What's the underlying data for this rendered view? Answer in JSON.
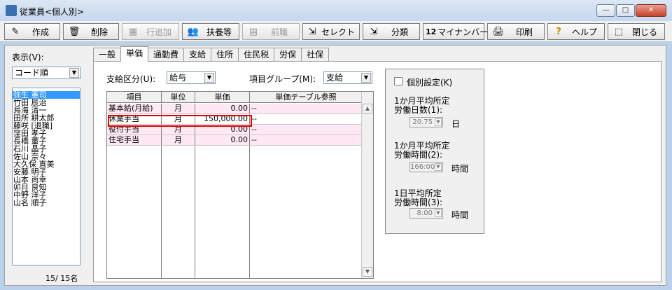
{
  "window": {
    "title": "従業員<個人別>",
    "min_glyph": "—",
    "max_glyph": "□",
    "close_glyph": "✕"
  },
  "toolbar": {
    "buttons": [
      {
        "label": "作成",
        "icon": "✎"
      },
      {
        "label": "削除",
        "icon": "🗑"
      },
      {
        "label": "行追加",
        "icon": "▦"
      },
      {
        "label": "扶養等",
        "icon": "👥"
      },
      {
        "label": "前職",
        "icon": "▤"
      },
      {
        "label": "セレクト",
        "icon": "⇲"
      },
      {
        "label": "分類",
        "icon": "⇲"
      },
      {
        "label": "マイナンバー",
        "icon": "12"
      },
      {
        "label": "印刷",
        "icon": "🖨"
      },
      {
        "label": "ヘルプ",
        "icon": "?"
      },
      {
        "label": "閉じる",
        "icon": "⬚"
      }
    ]
  },
  "left": {
    "display_label": "表示(V):",
    "sort_value": "コード順",
    "employees": [
      "弥生 憲司",
      "竹田 辰治",
      "鳥海 清一",
      "田所 耕太郎",
      "藤咲 [退職]",
      "窪田 孝子",
      "長橋 董子",
      "石川 晶子",
      "佐山 奈々",
      "大久保 直美",
      "安藤 明子",
      "山本 尚幸",
      "卯月 良知",
      "中野 洋子",
      "山名 順子"
    ],
    "count": "15/ 15名"
  },
  "tabs": [
    "一般",
    "単価",
    "通勤費",
    "支給",
    "住所",
    "住民税",
    "労保",
    "社保"
  ],
  "form": {
    "pay_type_label": "支給区分(U):",
    "pay_type_value": "給与",
    "item_group_label": "項目グループ(M):",
    "item_group_value": "支給"
  },
  "grid": {
    "headers": [
      "項目",
      "単位",
      "単価",
      "単価テーブル参照"
    ],
    "rows": [
      {
        "item": "基本給(月給)",
        "unit": "月",
        "price": "0.00",
        "ref": "--"
      },
      {
        "item": "休業手当",
        "unit": "月",
        "price": "150,000.00",
        "ref": "--"
      },
      {
        "item": "役付手当",
        "unit": "月",
        "price": "0.00",
        "ref": "--"
      },
      {
        "item": "住宅手当",
        "unit": "月",
        "price": "0.00",
        "ref": "--"
      }
    ]
  },
  "side": {
    "individual_setting": "個別設定(K)",
    "days_label_1": "1か月平均所定",
    "days_label_2": "労働日数(1):",
    "days_value": "20.75",
    "days_unit": "日",
    "hours_label_1": "1か月平均所定",
    "hours_label_2": "労働時間(2):",
    "hours_value": "166:00",
    "hours_unit": "時間",
    "daily_label_1": "1日平均所定",
    "daily_label_2": "労働時間(3):",
    "daily_value": "8:00",
    "daily_unit": "時間"
  }
}
